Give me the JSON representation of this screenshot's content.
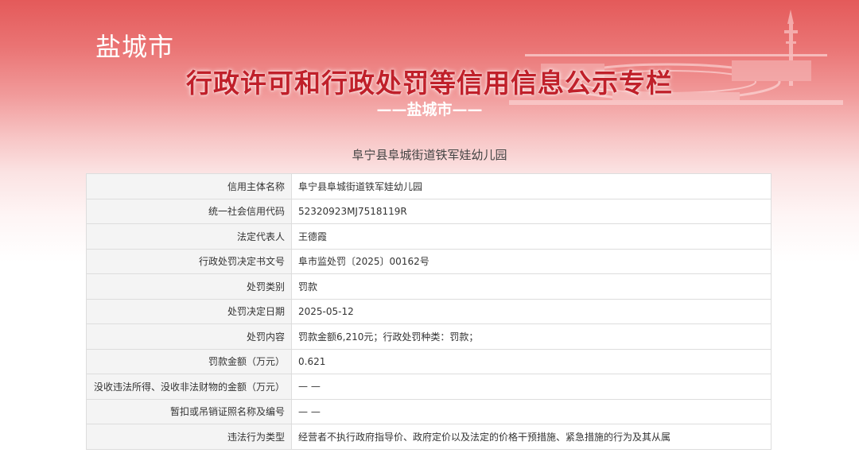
{
  "header": {
    "city_name": "盐城市",
    "main_title": "行政许可和行政处罚等信用信息公示专栏",
    "sub_title": "——盐城市——"
  },
  "entity_heading": "阜宁县阜城街道铁军娃幼儿园",
  "rows": [
    {
      "label": "信用主体名称",
      "value": "阜宁县阜城街道铁军娃幼儿园"
    },
    {
      "label": "统一社会信用代码",
      "value": "52320923MJ7518119R"
    },
    {
      "label": "法定代表人",
      "value": "王德霞"
    },
    {
      "label": "行政处罚决定书文号",
      "value": "阜市监处罚〔2025〕00162号"
    },
    {
      "label": "处罚类别",
      "value": "罚款"
    },
    {
      "label": "处罚决定日期",
      "value": "2025-05-12"
    },
    {
      "label": "处罚内容",
      "value": "罚款金额6,210元；行政处罚种类：罚款；"
    },
    {
      "label": "罚款金额（万元）",
      "value": "0.621"
    },
    {
      "label": "没收违法所得、没收非法财物的金额（万元）",
      "value": "— —"
    },
    {
      "label": "暂扣或吊销证照名称及编号",
      "value": "— —"
    },
    {
      "label": "违法行为类型",
      "value": "经营者不执行政府指导价、政府定价以及法定的价格干预措施、紧急措施的行为及其从属"
    }
  ],
  "colors": {
    "banner_red": "#e45a5a",
    "title_red": "#c0202a",
    "label_bg": "#f4f4f4",
    "border": "#dddddd"
  }
}
